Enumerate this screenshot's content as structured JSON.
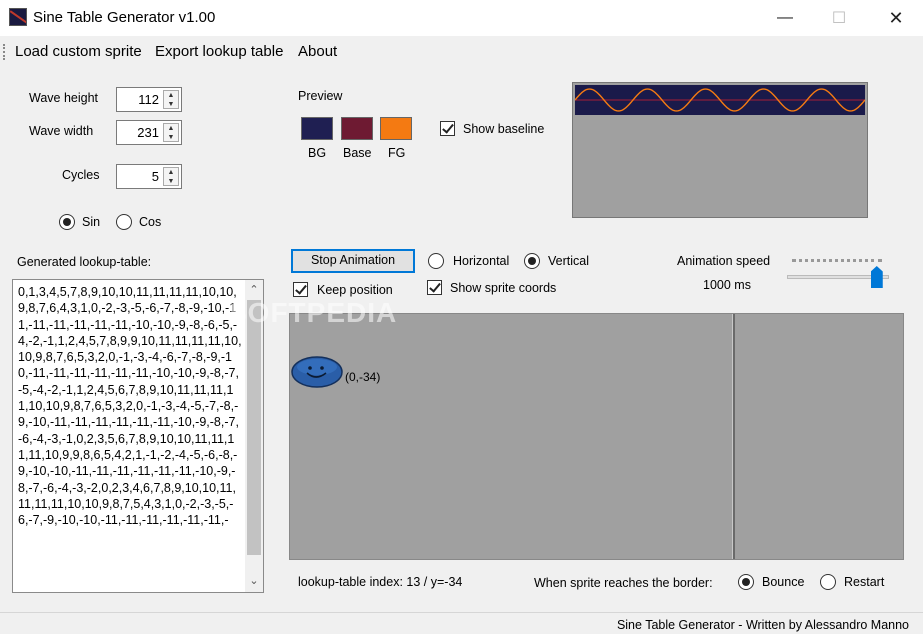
{
  "window": {
    "title": "Sine Table Generator v1.00",
    "minimize": "—",
    "maximize": "☐",
    "close": "✕"
  },
  "menu": {
    "load_sprite": "Load custom sprite",
    "export_table": "Export lookup table",
    "about": "About"
  },
  "params": {
    "wave_height_label": "Wave height",
    "wave_height": "112",
    "wave_width_label": "Wave width",
    "wave_width": "231",
    "cycles_label": "Cycles",
    "cycles": "5",
    "sin_label": "Sin",
    "cos_label": "Cos",
    "mode_selected": "Sin"
  },
  "preview": {
    "heading": "Preview",
    "bg_label": "BG",
    "base_label": "Base",
    "fg_label": "FG",
    "bg_color": "#1f1f52",
    "base_color": "#6e1a32",
    "fg_color": "#f47a12",
    "show_baseline_label": "Show baseline",
    "show_baseline": true
  },
  "lookup": {
    "heading": "Generated lookup-table:",
    "text": "0,1,3,4,5,7,8,9,10,10,11,11,11,11,10,10,9,8,7,6,4,3,1,0,-2,-3,-5,-6,-7,-8,-9,-10,-11,-11,-11,-11,-11,-11,-10,-10,-9,-8,-6,-5,-4,-2,-1,1,2,4,5,7,8,9,9,10,11,11,11,11,10,10,9,8,7,6,5,3,2,0,-1,-3,-4,-6,-7,-8,-9,-10,-11,-11,-11,-11,-11,-11,-10,-10,-9,-8,-7,-5,-4,-2,-1,1,2,4,5,6,7,8,9,10,11,11,11,11,10,10,9,8,7,6,5,3,2,0,-1,-3,-4,-5,-7,-8,-9,-10,-11,-11,-11,-11,-11,-11,-10,-9,-8,-7,-6,-4,-3,-1,0,2,3,5,6,7,8,9,10,10,11,11,11,11,10,9,9,8,6,5,4,2,1,-1,-2,-4,-5,-6,-8,-9,-10,-10,-11,-11,-11,-11,-11,-11,-10,-9,-8,-7,-6,-4,-3,-2,0,2,3,4,6,7,8,9,10,10,11,11,11,11,10,10,9,8,7,5,4,3,1,0,-2,-3,-5,-6,-7,-9,-10,-10,-11,-11,-11,-11,-11,-11,-"
  },
  "animation": {
    "stop_button": "Stop Animation",
    "horizontal_label": "Horizontal",
    "vertical_label": "Vertical",
    "direction_selected": "Vertical",
    "keep_position_label": "Keep position",
    "keep_position": true,
    "show_coords_label": "Show sprite coords",
    "show_coords": true,
    "speed_label": "Animation speed",
    "speed_value": "1000 ms",
    "speed_fraction": 0.88,
    "sprite_coords": "(0,-34)",
    "index_text": "lookup-table index: 13 / y=-34",
    "border_label": "When sprite reaches the border:",
    "bounce_label": "Bounce",
    "restart_label": "Restart",
    "border_selected": "Bounce"
  },
  "watermark": "SOFTPEDIA",
  "status": {
    "text": "Sine Table Generator - Written by Alessandro Manno"
  }
}
